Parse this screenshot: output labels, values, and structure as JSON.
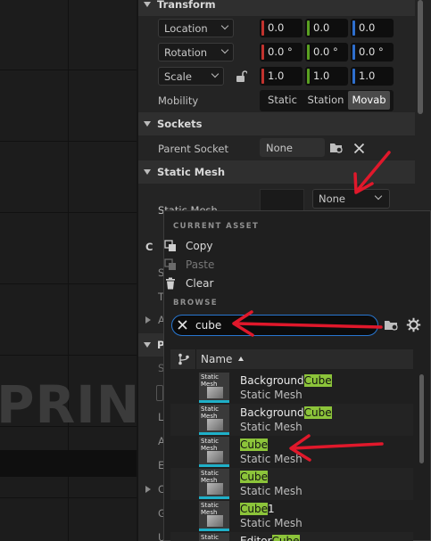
{
  "details": {
    "transform": {
      "header": "Transform",
      "location_label": "Location",
      "rotation_label": "Rotation",
      "scale_label": "Scale",
      "location": [
        "0.0",
        "0.0",
        "0.0"
      ],
      "rotation": [
        "0.0 °",
        "0.0 °",
        "0.0 °"
      ],
      "scale": [
        "1.0",
        "1.0",
        "1.0"
      ],
      "mobility_label": "Mobility",
      "mobility_options": [
        "Static",
        "Station",
        "Movab"
      ],
      "mobility_selected": "Movab"
    },
    "sockets": {
      "header": "Sockets",
      "parent_socket_label": "Parent Socket",
      "parent_socket_value": "None"
    },
    "static_mesh": {
      "header": "Static Mesh",
      "label": "Static Mesh",
      "value": "None"
    },
    "partial_labels": [
      "S",
      "T",
      "A",
      "P",
      "S",
      "L",
      "A",
      "E",
      "C",
      "G",
      "U"
    ]
  },
  "viewport": {
    "watermark": "PRINT"
  },
  "picker": {
    "current_asset_header": "CURRENT ASSET",
    "copy_label": "Copy",
    "paste_label": "Paste",
    "clear_label": "Clear",
    "browse_header": "BROWSE",
    "search_value": "cube",
    "column_name": "Name",
    "thumb_label": "Static\nMesh",
    "items": [
      {
        "prefix": "Background",
        "match": "Cube",
        "suffix": "",
        "type": "Static Mesh"
      },
      {
        "prefix": "Background",
        "match": "Cube",
        "suffix": "",
        "type": "Static Mesh"
      },
      {
        "prefix": "",
        "match": "Cube",
        "suffix": "",
        "type": "Static Mesh"
      },
      {
        "prefix": "",
        "match": "Cube",
        "suffix": "",
        "type": "Static Mesh"
      },
      {
        "prefix": "",
        "match": "Cube",
        "suffix": "1",
        "type": "Static Mesh"
      },
      {
        "prefix": "Editor",
        "match": "Cube",
        "suffix": "",
        "type": "Static Mesh"
      }
    ]
  },
  "colors": {
    "accent_blue": "#2877d1",
    "highlight_green": "#8cc43a",
    "annotation_red": "#e0182b",
    "thumb_bar": "#1fb0c8"
  }
}
